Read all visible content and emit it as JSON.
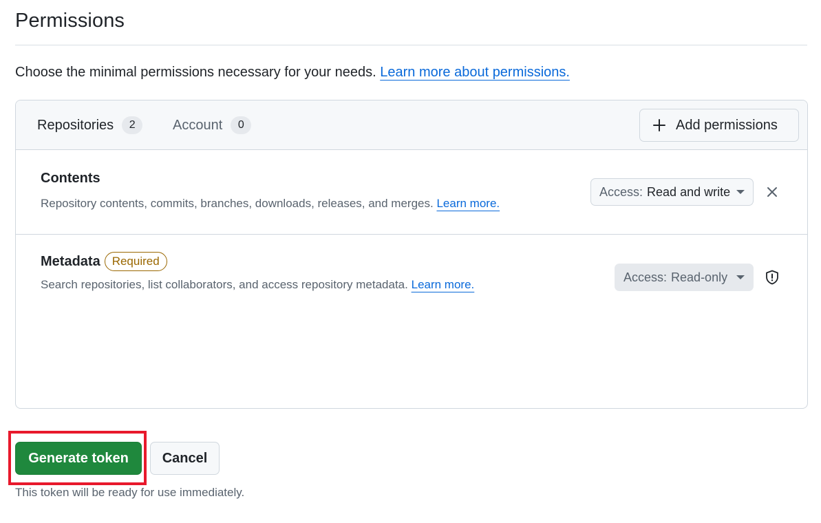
{
  "page": {
    "title": "Permissions",
    "intro_text": "Choose the minimal permissions necessary for your needs.",
    "intro_link": "Learn more about permissions."
  },
  "tabs": [
    {
      "label": "Repositories",
      "count": "2",
      "active": true
    },
    {
      "label": "Account",
      "count": "0",
      "active": false
    }
  ],
  "add_permissions_label": "Add permissions",
  "permissions": [
    {
      "name": "Contents",
      "badge": "",
      "description": "Repository contents, commits, branches, downloads, releases, and merges.",
      "link": "Learn more.",
      "access_label": "Access:",
      "access_value": "Read and write",
      "icon": "close-icon"
    },
    {
      "name": "Metadata",
      "badge": "Required",
      "description": "Search repositories, list collaborators, and access repository metadata.",
      "link": "Learn more.",
      "access_label": "Access:",
      "access_value": "Read-only",
      "icon": "shield-alert-icon"
    }
  ],
  "actions": {
    "generate_label": "Generate token",
    "cancel_label": "Cancel",
    "note": "This token will be ready for use immediately."
  },
  "colors": {
    "primary_green": "#1f883d",
    "link_blue": "#0969da",
    "required_amber": "#9a6700",
    "highlight_red": "#e8192c"
  }
}
